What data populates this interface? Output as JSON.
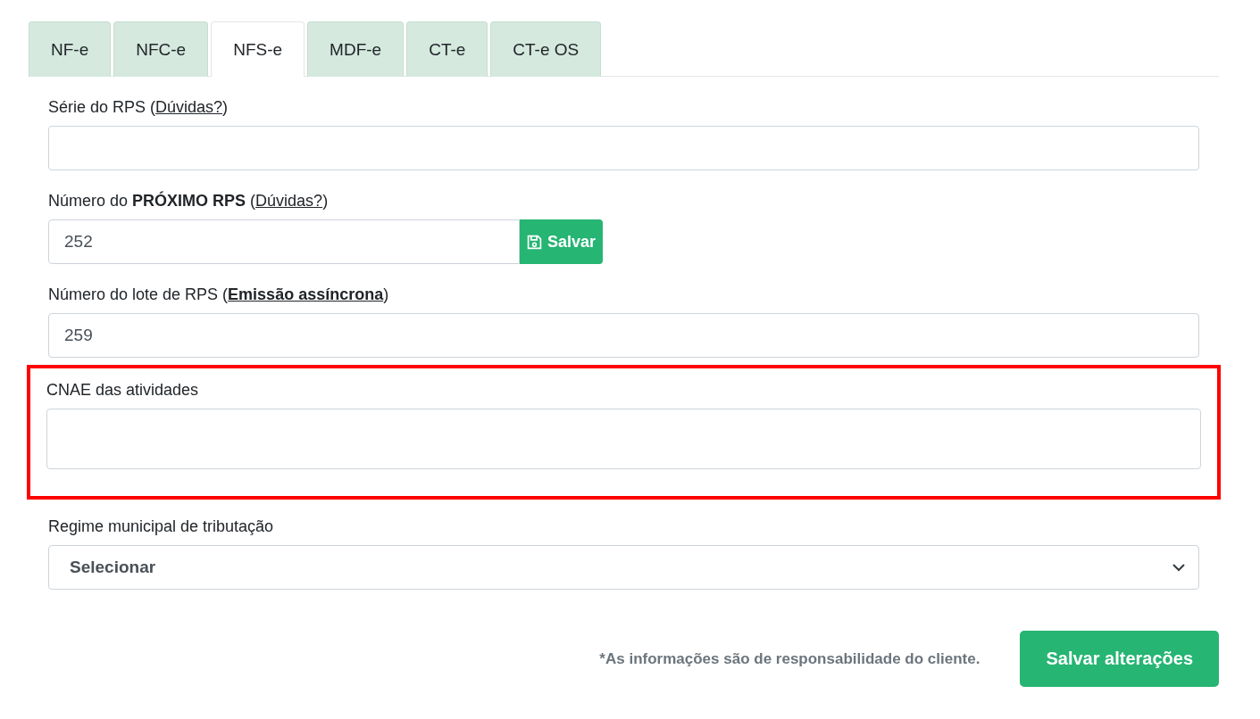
{
  "tabs": [
    {
      "label": "NF-e",
      "selected": false
    },
    {
      "label": "NFC-e",
      "selected": false
    },
    {
      "label": "NFS-e",
      "selected": true
    },
    {
      "label": "MDF-e",
      "selected": false
    },
    {
      "label": "CT-e",
      "selected": false
    },
    {
      "label": "CT-e OS",
      "selected": false
    }
  ],
  "fields": [
    {
      "kind": "input",
      "label": "Série do RPS (",
      "link": "Dúvidas?",
      "link_bold": false,
      "label_end": ")",
      "highlighted": false
    },
    {
      "kind": "input-button",
      "label": "Número do **PRÓXIMO RPS** (",
      "link": "Dúvidas?",
      "link_bold": false,
      "label_end": ")",
      "value": "252",
      "button": "Salvar",
      "highlighted": false
    },
    {
      "kind": "input",
      "label": "Número do lote de RPS (",
      "link": "Emissão assíncrona",
      "link_bold": true,
      "label_end": ")",
      "value": "259",
      "highlighted": false
    },
    {
      "kind": "textarea",
      "label": "CNAE das atividades",
      "highlighted": true
    },
    {
      "kind": "select",
      "label": "Regime municipal de tributação",
      "value": "Selecionar",
      "highlighted": false
    }
  ],
  "footer": {
    "note": "*As informações são de responsabilidade do cliente.",
    "button": "Salvar alterações"
  }
}
